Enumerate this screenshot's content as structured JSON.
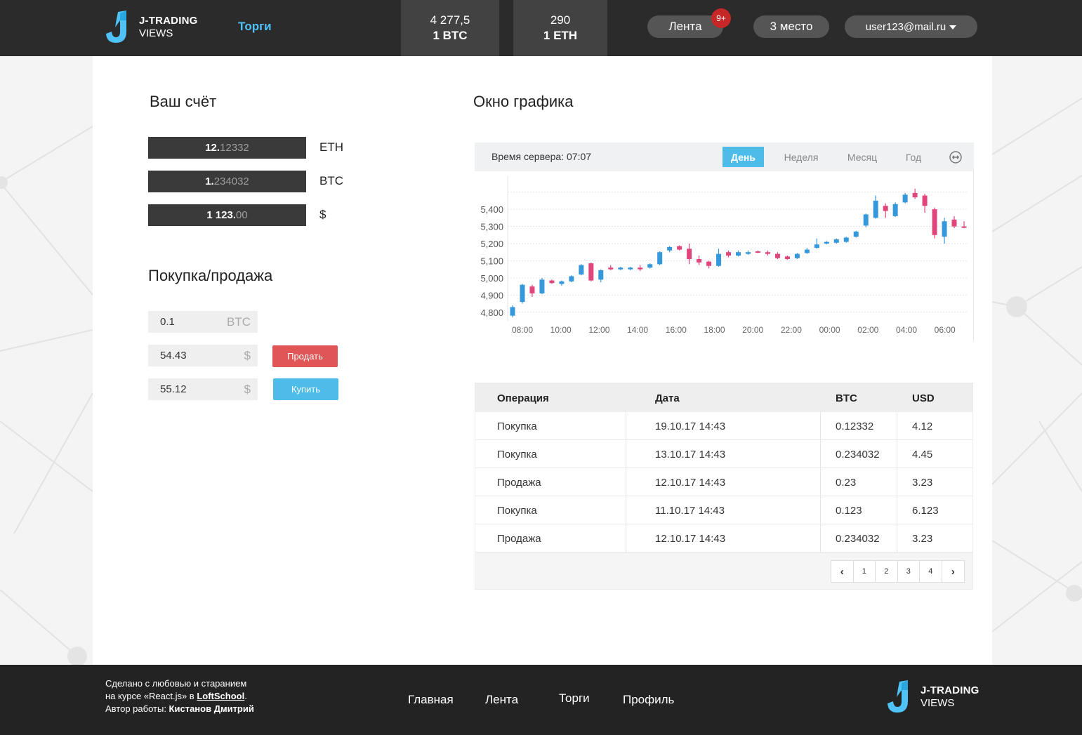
{
  "header": {
    "logo": {
      "line1": "J-TRADING",
      "line2": "VIEWS"
    },
    "nav_torgi": "Торги",
    "rates": [
      {
        "value": "4 277,5",
        "currency": "1 BTC"
      },
      {
        "value": "290",
        "currency": "1 ETH"
      }
    ],
    "feed_label": "Лента",
    "feed_badge": "9+",
    "place_label": "3 место",
    "user_email": "user123@mail.ru"
  },
  "account": {
    "title": "Ваш счёт",
    "balances": [
      {
        "int": "12.",
        "frac": "12332",
        "currency": "ETH"
      },
      {
        "int": "1.",
        "frac": "234032",
        "currency": "BTC"
      },
      {
        "int": "1 123.",
        "frac": "00",
        "currency": "$"
      }
    ]
  },
  "trade": {
    "title": "Покупка/продажа",
    "amount_value": "0.1",
    "amount_unit": "BTC",
    "sell_price": "54.43",
    "sell_unit": "$",
    "buy_price": "55.12",
    "buy_unit": "$",
    "sell_label": "Продать",
    "buy_label": "Купить"
  },
  "chart_panel": {
    "title": "Окно графика",
    "server_time": "Время сервера: 07:07",
    "periods": [
      "День",
      "Неделя",
      "Месяц",
      "Год"
    ],
    "active_period": "День"
  },
  "colors": {
    "up": "#3498db",
    "down": "#e0457b",
    "accent": "#4dbce9",
    "sell": "#e05555"
  },
  "chart_data": {
    "type": "candlestick",
    "ylim": [
      4750,
      5560
    ],
    "y_ticks": [
      "4,800",
      "4,900",
      "5,000",
      "5,100",
      "5,200",
      "5,300",
      "5,400"
    ],
    "y_tick_values": [
      4800,
      4900,
      5000,
      5100,
      5200,
      5300,
      5400
    ],
    "x_ticks": [
      "08:00",
      "10:00",
      "12:00",
      "14:00",
      "16:00",
      "18:00",
      "20:00",
      "22:00",
      "00:00",
      "02:00",
      "04:00",
      "06:00"
    ],
    "candles": [
      {
        "o": 4780,
        "c": 4830,
        "h": 4840,
        "l": 4770
      },
      {
        "o": 4860,
        "c": 4960,
        "h": 4965,
        "l": 4850
      },
      {
        "o": 4950,
        "c": 4910,
        "h": 4960,
        "l": 4890
      },
      {
        "o": 4910,
        "c": 4990,
        "h": 5000,
        "l": 4905
      },
      {
        "o": 4985,
        "c": 4970,
        "h": 4990,
        "l": 4965
      },
      {
        "o": 4965,
        "c": 4980,
        "h": 4985,
        "l": 4955
      },
      {
        "o": 4980,
        "c": 5010,
        "h": 5015,
        "l": 4975
      },
      {
        "o": 5020,
        "c": 5075,
        "h": 5080,
        "l": 5015
      },
      {
        "o": 5085,
        "c": 4985,
        "h": 5090,
        "l": 4980
      },
      {
        "o": 4990,
        "c": 5045,
        "h": 5050,
        "l": 4975
      },
      {
        "o": 5060,
        "c": 5050,
        "h": 5075,
        "l": 5045
      },
      {
        "o": 5050,
        "c": 5060,
        "h": 5065,
        "l": 5045
      },
      {
        "o": 5050,
        "c": 5060,
        "h": 5065,
        "l": 5045
      },
      {
        "o": 5060,
        "c": 5050,
        "h": 5075,
        "l": 5040
      },
      {
        "o": 5060,
        "c": 5080,
        "h": 5085,
        "l": 5055
      },
      {
        "o": 5080,
        "c": 5150,
        "h": 5155,
        "l": 5075
      },
      {
        "o": 5160,
        "c": 5180,
        "h": 5185,
        "l": 5150
      },
      {
        "o": 5185,
        "c": 5165,
        "h": 5190,
        "l": 5160
      },
      {
        "o": 5170,
        "c": 5110,
        "h": 5200,
        "l": 5080
      },
      {
        "o": 5110,
        "c": 5090,
        "h": 5130,
        "l": 5075
      },
      {
        "o": 5095,
        "c": 5070,
        "h": 5100,
        "l": 5055
      },
      {
        "o": 5070,
        "c": 5140,
        "h": 5170,
        "l": 5065
      },
      {
        "o": 5150,
        "c": 5130,
        "h": 5160,
        "l": 5120
      },
      {
        "o": 5130,
        "c": 5150,
        "h": 5160,
        "l": 5125
      },
      {
        "o": 5140,
        "c": 5150,
        "h": 5160,
        "l": 5135
      },
      {
        "o": 5155,
        "c": 5150,
        "h": 5160,
        "l": 5145
      },
      {
        "o": 5150,
        "c": 5140,
        "h": 5160,
        "l": 5130
      },
      {
        "o": 5140,
        "c": 5115,
        "h": 5150,
        "l": 5110
      },
      {
        "o": 5125,
        "c": 5110,
        "h": 5130,
        "l": 5105
      },
      {
        "o": 5115,
        "c": 5140,
        "h": 5145,
        "l": 5110
      },
      {
        "o": 5145,
        "c": 5165,
        "h": 5175,
        "l": 5140
      },
      {
        "o": 5175,
        "c": 5195,
        "h": 5230,
        "l": 5170
      },
      {
        "o": 5200,
        "c": 5210,
        "h": 5215,
        "l": 5195
      },
      {
        "o": 5205,
        "c": 5225,
        "h": 5230,
        "l": 5200
      },
      {
        "o": 5210,
        "c": 5235,
        "h": 5240,
        "l": 5205
      },
      {
        "o": 5240,
        "c": 5270,
        "h": 5275,
        "l": 5235
      },
      {
        "o": 5305,
        "c": 5370,
        "h": 5375,
        "l": 5295
      },
      {
        "o": 5350,
        "c": 5450,
        "h": 5480,
        "l": 5345
      },
      {
        "o": 5420,
        "c": 5390,
        "h": 5435,
        "l": 5350
      },
      {
        "o": 5360,
        "c": 5430,
        "h": 5440,
        "l": 5355
      },
      {
        "o": 5440,
        "c": 5485,
        "h": 5495,
        "l": 5435
      },
      {
        "o": 5495,
        "c": 5470,
        "h": 5520,
        "l": 5460
      },
      {
        "o": 5480,
        "c": 5420,
        "h": 5490,
        "l": 5380
      },
      {
        "o": 5400,
        "c": 5250,
        "h": 5410,
        "l": 5230
      },
      {
        "o": 5240,
        "c": 5330,
        "h": 5350,
        "l": 5200
      },
      {
        "o": 5340,
        "c": 5300,
        "h": 5360,
        "l": 5290
      },
      {
        "o": 5300,
        "c": 5295,
        "h": 5330,
        "l": 5290
      }
    ]
  },
  "transactions": {
    "headers": [
      "Операция",
      "Дата",
      "BTC",
      "USD"
    ],
    "rows": [
      [
        "Покупка",
        "19.10.17 14:43",
        "0.12332",
        "4.12"
      ],
      [
        "Покупка",
        "13.10.17 14:43",
        "0.234032",
        "4.45"
      ],
      [
        "Продажа",
        "12.10.17 14:43",
        "0.23",
        "3.23"
      ],
      [
        "Покупка",
        "11.10.17 14:43",
        "0.123",
        "6.123"
      ],
      [
        "Продажа",
        "12.10.17 14:43",
        "0.234032",
        "3.23"
      ]
    ],
    "pages": [
      "1",
      "2",
      "3",
      "4"
    ],
    "prev_glyph": "‹",
    "next_glyph": "›"
  },
  "footer": {
    "line1": "Сделано с любовью и старанием",
    "line2_pre": "на курсе «React.js» в ",
    "line2_link": "LoftSchool",
    "line2_post": ".",
    "line3_pre": "Автор работы: ",
    "line3_name": "Кистанов Дмитрий",
    "nav": [
      "Главная",
      "Лента",
      "Торги",
      "Профиль"
    ],
    "logo": {
      "line1": "J-TRADING",
      "line2": "VIEWS"
    }
  }
}
